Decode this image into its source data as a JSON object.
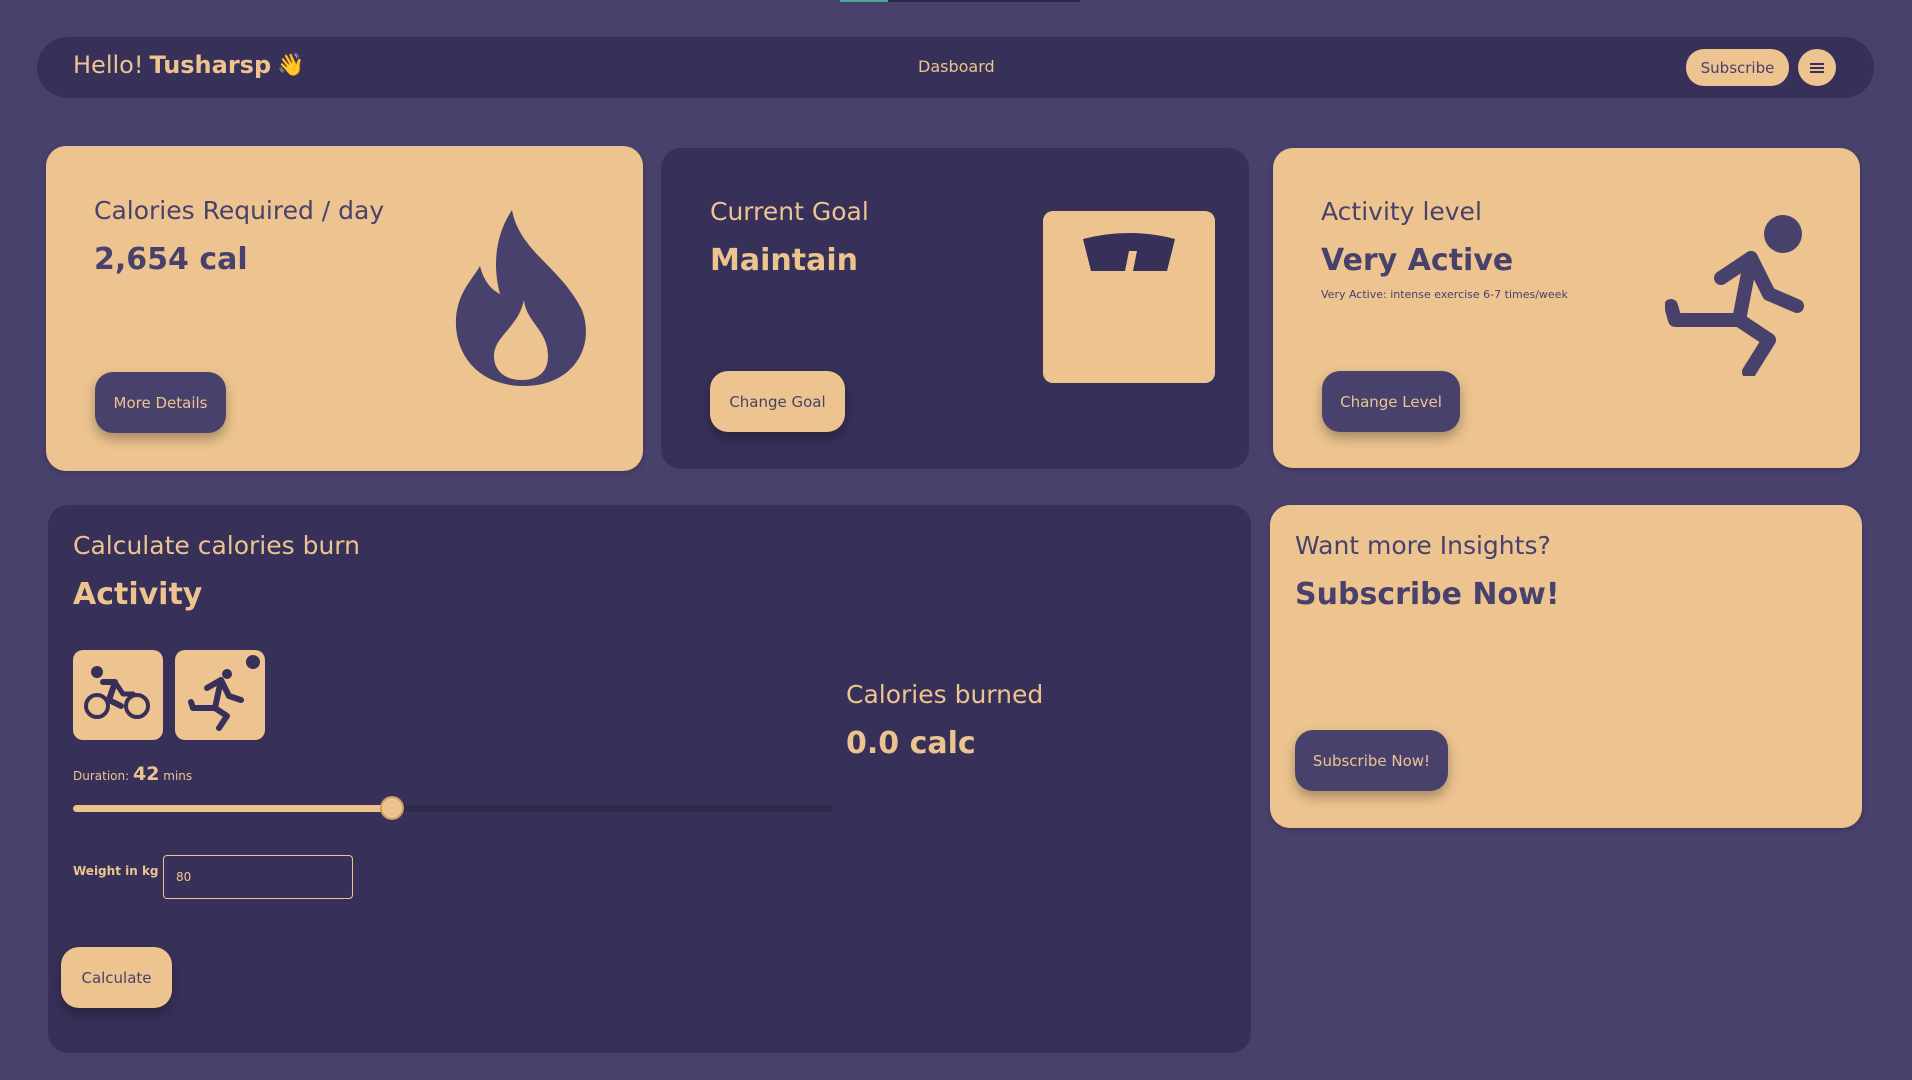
{
  "header": {
    "greeting": "Hello!",
    "username": "Tusharsp",
    "wave_emoji": "👋",
    "nav_link": "Dasboard",
    "subscribe_label": "Subscribe",
    "menu_icon": "hamburger-menu-icon"
  },
  "cards": {
    "calories": {
      "subtitle": "Calories Required / day",
      "value": "2,654 cal",
      "button": "More Details",
      "icon": "fire-icon"
    },
    "goal": {
      "subtitle": "Current Goal",
      "value": "Maintain",
      "button": "Change Goal",
      "icon": "weighing-scale-icon"
    },
    "activity_level": {
      "subtitle": "Activity level",
      "value": "Very Active",
      "note": "Very Active: intense exercise 6-7 times/week",
      "button": "Change Level",
      "icon": "running-person-icon"
    }
  },
  "burn": {
    "subtitle": "Calculate calories burn",
    "title": "Activity",
    "activities": [
      {
        "icon": "cycling-icon"
      },
      {
        "icon": "running-icon"
      }
    ],
    "duration_label": "Duration:",
    "duration_value": "42",
    "duration_unit": "mins",
    "duration_fraction": 0.42,
    "weight_label": "Weight in kg",
    "weight_value": "80",
    "calc_button": "Calculate",
    "result_label": "Calories burned",
    "result_value": "0.0 calc"
  },
  "insights": {
    "subtitle": "Want more Insights?",
    "title": "Subscribe Now!",
    "button": "Subscribe Now!"
  },
  "colors": {
    "background": "#48416c",
    "panel": "#37315a",
    "accent": "#edc48f"
  }
}
